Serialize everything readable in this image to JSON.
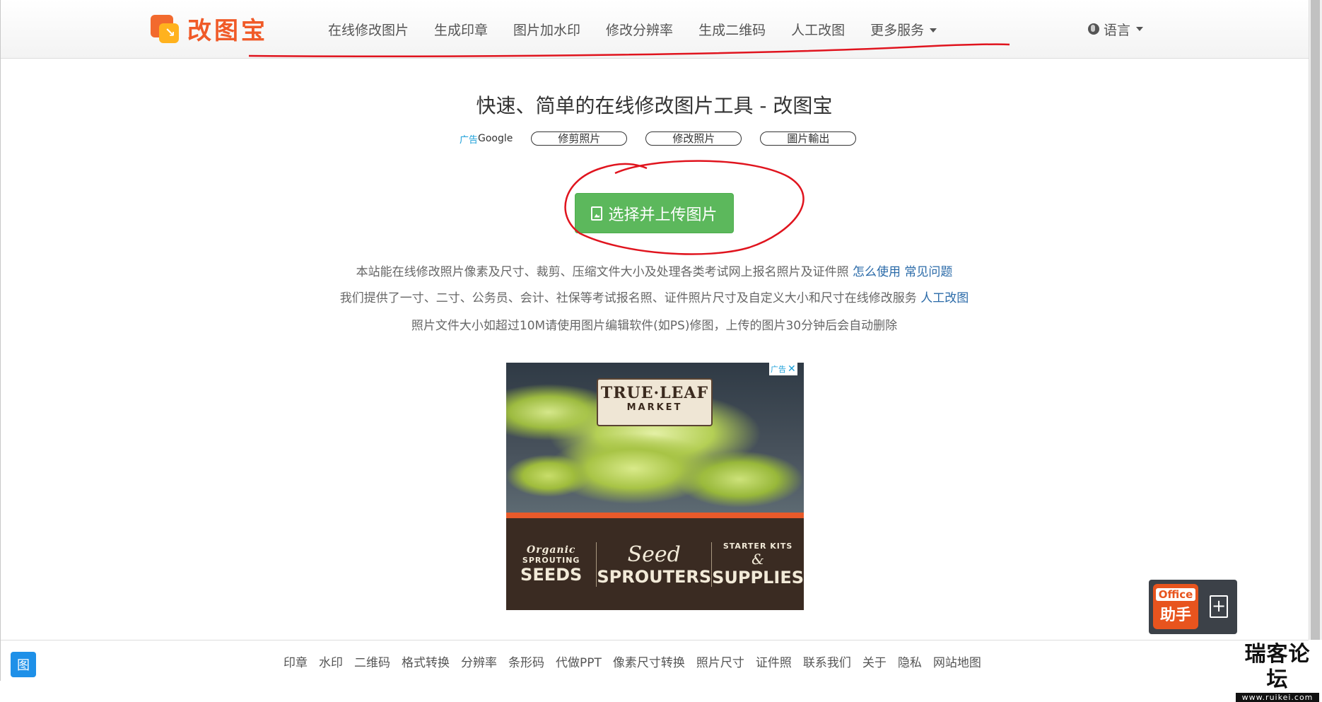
{
  "navbar": {
    "logo_text": "改图宝",
    "items": [
      {
        "label": "在线修改图片"
      },
      {
        "label": "生成印章"
      },
      {
        "label": "图片加水印"
      },
      {
        "label": "修改分辨率"
      },
      {
        "label": "生成二维码"
      },
      {
        "label": "人工改图"
      },
      {
        "label": "更多服务"
      }
    ],
    "language_label": "语言"
  },
  "main": {
    "headline": "快速、简单的在线修改图片工具 - 改图宝",
    "ad_links": {
      "tag": "广告",
      "provider": "Google",
      "pills": [
        "修剪照片",
        "修改照片",
        "圖片輸出"
      ]
    },
    "upload_button": "选择并上传图片",
    "desc_lines": [
      {
        "text": "本站能在线修改照片像素及尺寸、裁剪、压缩文件大小及处理各类考试网上报名照片及证件照",
        "links": [
          "怎么使用",
          "常见问题"
        ]
      },
      {
        "text": "我们提供了一寸、二寸、公务员、会计、社保等考试报名照、证件照片尺寸及自定义大小和尺寸在线修改服务",
        "links": [
          "人工改图"
        ]
      },
      {
        "text": "照片文件大小如超过10M请使用图片编辑软件(如PS)修图，上传的图片30分钟后会自动删除",
        "links": []
      }
    ]
  },
  "ad_banner": {
    "close_label": "广告",
    "brand_line1": "TRUE·LEAF",
    "brand_line2": "MARKET",
    "col1_small": "Organic",
    "col1_mid": "SPROUTING",
    "col1_large": "SEEDS",
    "col2_script": "Seed",
    "col2_large": "SPROUTERS",
    "col3_top": "STARTER KITS",
    "col3_amp": "&",
    "col3_large": "SUPPLIES"
  },
  "footer": {
    "badge": "图",
    "links": [
      "印章",
      "水印",
      "二维码",
      "格式转换",
      "分辨率",
      "条形码",
      "代做PPT",
      "像素尺寸转换",
      "照片尺寸",
      "证件照",
      "联系我们",
      "关于",
      "隐私",
      "网站地图"
    ]
  },
  "office_widget": {
    "label_top": "Office",
    "label_bottom": "助手",
    "add_symbol": "+"
  },
  "watermark": {
    "title": "瑞客论坛",
    "url": "www.ruikei.com"
  },
  "colors": {
    "brand": "#f05a28",
    "upload_green": "#5cb85c",
    "link_blue": "#2a6aa8",
    "annotation_red": "#e0141e"
  }
}
